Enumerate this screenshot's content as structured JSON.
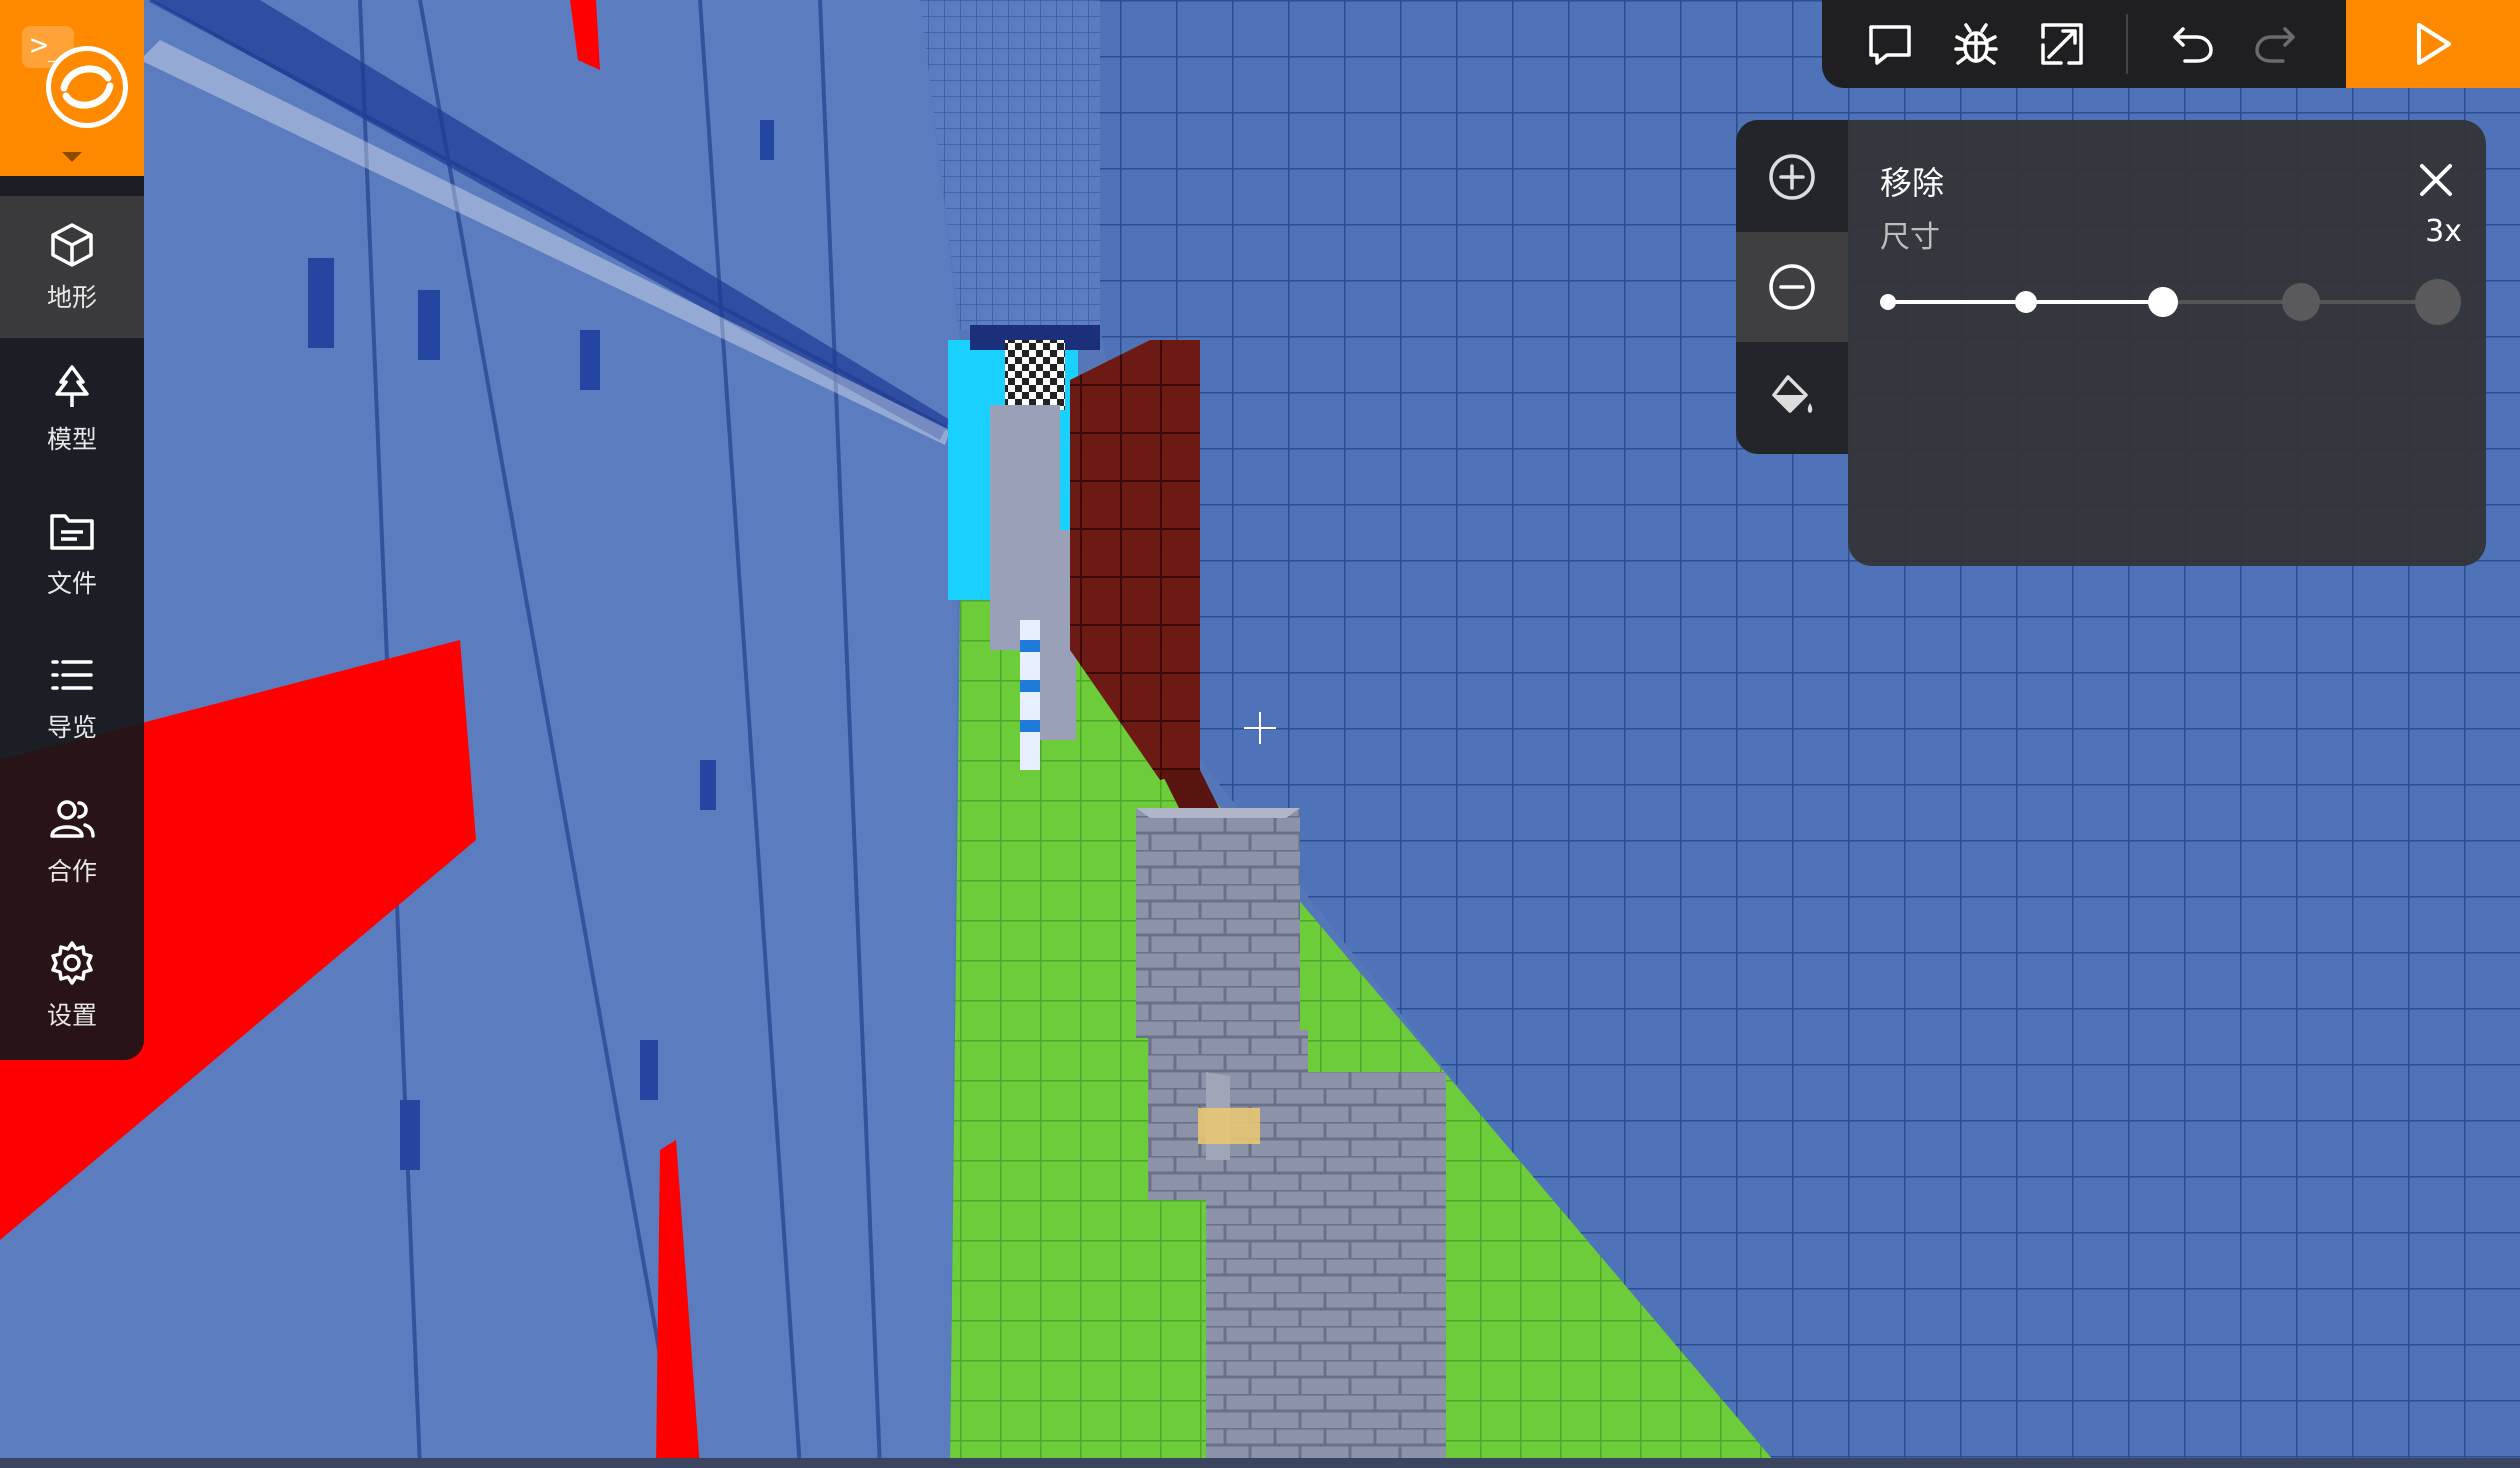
{
  "sidebar": {
    "items": [
      {
        "label": "地形",
        "icon": "cube-icon",
        "active": true
      },
      {
        "label": "模型",
        "icon": "tree-icon",
        "active": false
      },
      {
        "label": "文件",
        "icon": "file-icon",
        "active": false
      },
      {
        "label": "导览",
        "icon": "list-icon",
        "active": false
      },
      {
        "label": "合作",
        "icon": "users-icon",
        "active": false
      },
      {
        "label": "设置",
        "icon": "gear-icon",
        "active": false
      }
    ]
  },
  "toolbar": {
    "buttons": [
      "chat-icon",
      "bug-icon",
      "resize-icon",
      "undo-icon",
      "redo-icon"
    ],
    "play": "play-icon"
  },
  "tools": [
    "add-block-icon",
    "remove-block-icon",
    "paint-bucket-icon"
  ],
  "panel": {
    "title": "移除",
    "size_label": "尺寸",
    "size_value": "3x",
    "size_options": [
      "1x",
      "2x",
      "3x",
      "4x",
      "5x"
    ],
    "selected_index": 2
  },
  "colors": {
    "accent": "#ff8a00",
    "sidebar_bg": "#161618",
    "panel_bg": "#343437"
  }
}
